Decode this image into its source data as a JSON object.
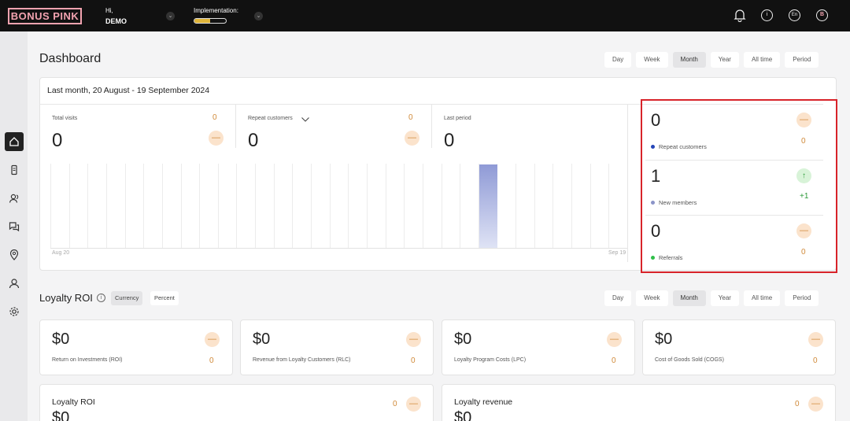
{
  "topbar": {
    "logo": "BONUS PINK",
    "greeting": "Hi,",
    "user": "DEMO",
    "implementation_label": "Implementation:",
    "implementation_progress": 0.5,
    "lang": "En",
    "avatar_letter": "B"
  },
  "sidebar": {
    "items": [
      {
        "icon": "home-icon"
      },
      {
        "icon": "device-icon"
      },
      {
        "icon": "users-icon"
      },
      {
        "icon": "chat-icon"
      },
      {
        "icon": "location-icon"
      },
      {
        "icon": "user-icon"
      },
      {
        "icon": "settings-icon"
      }
    ]
  },
  "dashboard": {
    "title": "Dashboard",
    "periods": [
      "Day",
      "Week",
      "Month",
      "Year",
      "All time",
      "Period"
    ],
    "active_period": "Month",
    "date_range": "Last month, 20 August - 19 September 2024",
    "metrics": [
      {
        "label": "Total visits",
        "value": "0",
        "delta": "0"
      },
      {
        "label": "Repeat customers",
        "value": "0",
        "delta": "0"
      },
      {
        "label": "Last period",
        "value": "0"
      }
    ],
    "chart_start": "Aug 20",
    "chart_end": "Sep 19",
    "side_stats": [
      {
        "value": "0",
        "label": "Repeat customers",
        "delta": "0",
        "color": "#2546b8"
      },
      {
        "value": "1",
        "label": "New members",
        "delta": "+1",
        "color": "#8b94c8"
      },
      {
        "value": "0",
        "label": "Referrals",
        "delta": "0",
        "color": "#2fbf49"
      }
    ]
  },
  "roi": {
    "title": "Loyalty ROI",
    "toggles": [
      "Currency",
      "Percent"
    ],
    "active_toggle": "Currency",
    "periods": [
      "Day",
      "Week",
      "Month",
      "Year",
      "All time",
      "Period"
    ],
    "active_period": "Month",
    "cards": [
      {
        "value": "$0",
        "label": "Return on Investments (ROI)",
        "delta": "0"
      },
      {
        "value": "$0",
        "label": "Revenue from Loyalty Customers (RLC)",
        "delta": "0"
      },
      {
        "value": "$0",
        "label": "Loyalty Program Costs (LPC)",
        "delta": "0"
      },
      {
        "value": "$0",
        "label": "Cost of Goods Sold (COGS)",
        "delta": "0"
      }
    ],
    "bottom_cards": [
      {
        "title": "Loyalty ROI",
        "delta": "0",
        "value": "$0"
      },
      {
        "title": "Loyalty revenue",
        "delta": "0",
        "value": "$0"
      }
    ]
  }
}
